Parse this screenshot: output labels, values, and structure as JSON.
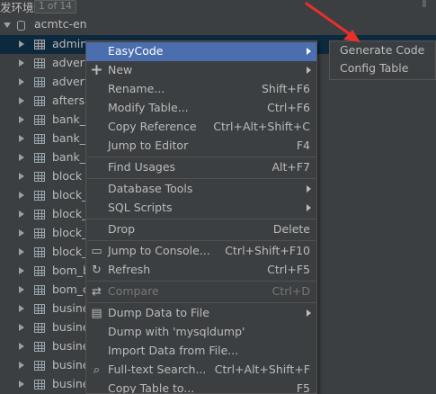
{
  "header": {
    "title": "发环境",
    "count": "1 of 14"
  },
  "tree": {
    "schema": {
      "label": "acmtc-en"
    },
    "tables": [
      {
        "label": "admin",
        "selected": true
      },
      {
        "label": "advert"
      },
      {
        "label": "advert"
      },
      {
        "label": "aftersa"
      },
      {
        "label": "bank_c"
      },
      {
        "label": "bank_c"
      },
      {
        "label": "bank_c"
      },
      {
        "label": "block"
      },
      {
        "label": "block_"
      },
      {
        "label": "block_"
      },
      {
        "label": "block_"
      },
      {
        "label": "block_"
      },
      {
        "label": "bom_b"
      },
      {
        "label": "bom_c"
      },
      {
        "label": "busine"
      },
      {
        "label": "busine"
      },
      {
        "label": "busine"
      },
      {
        "label": "busine"
      },
      {
        "label": "busine"
      }
    ]
  },
  "context_menu": {
    "items": [
      {
        "label": "EasyCode",
        "shortcut": "",
        "icon": "",
        "submenu": true,
        "highlighted": true
      },
      {
        "label": "New",
        "shortcut": "",
        "icon": "plus-icon",
        "submenu": true
      },
      {
        "label": "Rename...",
        "shortcut": "Shift+F6"
      },
      {
        "label": "Modify Table...",
        "shortcut": "Ctrl+F6"
      },
      {
        "label": "Copy Reference",
        "shortcut": "Ctrl+Alt+Shift+C"
      },
      {
        "label": "Jump to Editor",
        "shortcut": "F4"
      },
      {
        "label": "Find Usages",
        "shortcut": "Alt+F7",
        "separator_before": true
      },
      {
        "label": "Database Tools",
        "shortcut": "",
        "submenu": true,
        "separator_before": true
      },
      {
        "label": "SQL Scripts",
        "shortcut": "",
        "submenu": true
      },
      {
        "label": "Drop",
        "shortcut": "Delete",
        "separator_before": true
      },
      {
        "label": "Jump to Console...",
        "shortcut": "Ctrl+Shift+F10",
        "icon": "console-icon",
        "separator_before": true
      },
      {
        "label": "Refresh",
        "shortcut": "Ctrl+F5",
        "icon": "refresh-icon"
      },
      {
        "label": "Compare",
        "shortcut": "Ctrl+D",
        "icon": "compare-icon",
        "disabled": true,
        "separator_before": true
      },
      {
        "label": "Dump Data to File",
        "shortcut": "",
        "icon": "dump-icon",
        "submenu": true,
        "separator_before": true
      },
      {
        "label": "Dump with 'mysqldump'",
        "shortcut": ""
      },
      {
        "label": "Import Data from File...",
        "shortcut": ""
      },
      {
        "label": "Full-text Search...",
        "shortcut": "Ctrl+Alt+Shift+F",
        "icon": "search-icon"
      },
      {
        "label": "Copy Table to...",
        "shortcut": "F5"
      }
    ]
  },
  "submenu": {
    "items": [
      {
        "label": "Generate Code"
      },
      {
        "label": "Config Table"
      }
    ]
  },
  "colors": {
    "background": "#3c3f41",
    "menu_highlight": "#4b6eaf",
    "selected_row": "#0d293e",
    "annotation_arrow": "#e8302a"
  }
}
